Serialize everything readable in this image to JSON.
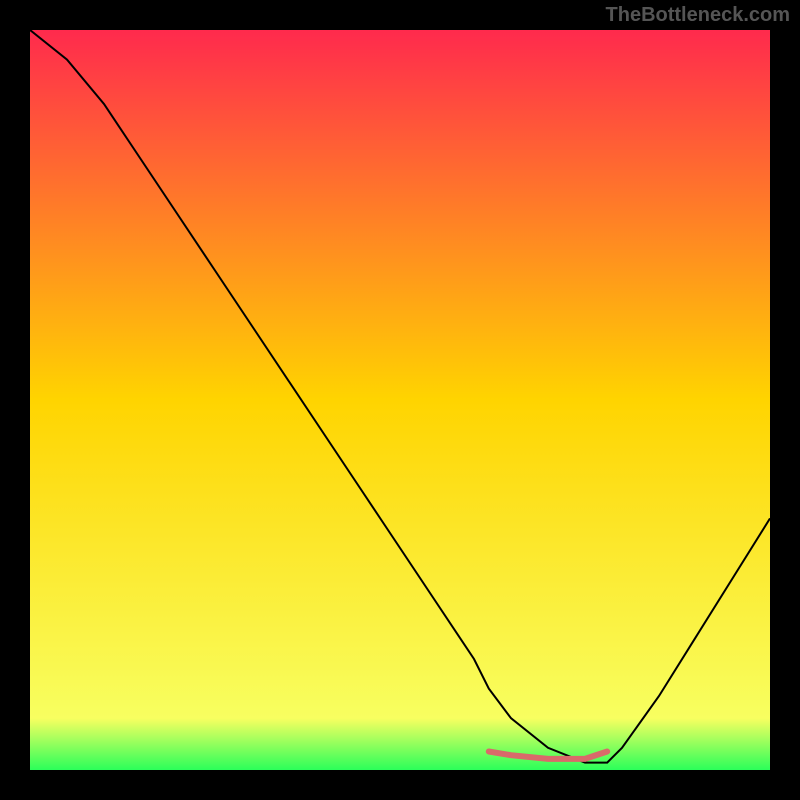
{
  "watermark": "TheBottleneck.com",
  "chart_data": {
    "type": "line",
    "title": "",
    "xlabel": "",
    "ylabel": "",
    "xlim": [
      0,
      100
    ],
    "ylim": [
      0,
      100
    ],
    "gradient_stops": [
      {
        "offset": 0,
        "color": "#ff2a4d"
      },
      {
        "offset": 50,
        "color": "#ffd400"
      },
      {
        "offset": 93,
        "color": "#f8ff60"
      },
      {
        "offset": 100,
        "color": "#2bff5a"
      }
    ],
    "series": [
      {
        "name": "bottleneck-curve",
        "color": "#000000",
        "width": 2,
        "x": [
          0,
          5,
          10,
          15,
          20,
          25,
          30,
          35,
          40,
          45,
          50,
          55,
          60,
          62,
          65,
          70,
          75,
          78,
          80,
          85,
          90,
          95,
          100
        ],
        "y": [
          100,
          96,
          90,
          82.5,
          75,
          67.5,
          60,
          52.5,
          45,
          37.5,
          30,
          22.5,
          15,
          11,
          7,
          3,
          1,
          1,
          3,
          10,
          18,
          26,
          34
        ]
      },
      {
        "name": "optimal-range",
        "color": "#d96a6a",
        "width": 6,
        "x": [
          62,
          65,
          70,
          75,
          78
        ],
        "y": [
          2.5,
          2,
          1.5,
          1.5,
          2.5
        ]
      }
    ]
  }
}
